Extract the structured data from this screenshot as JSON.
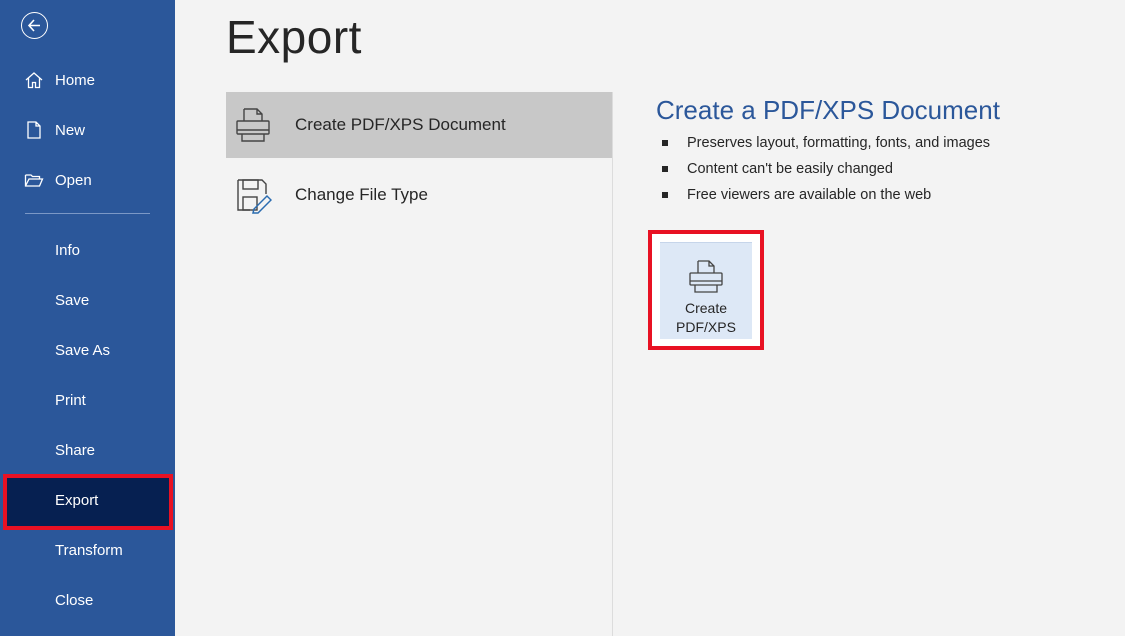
{
  "page": {
    "title": "Export"
  },
  "sidebar": {
    "items_top": [
      {
        "label": "Home",
        "icon": "home-icon"
      },
      {
        "label": "New",
        "icon": "new-document-icon"
      },
      {
        "label": "Open",
        "icon": "open-folder-icon"
      }
    ],
    "items_bottom": [
      {
        "label": "Info"
      },
      {
        "label": "Save"
      },
      {
        "label": "Save As"
      },
      {
        "label": "Print"
      },
      {
        "label": "Share"
      },
      {
        "label": "Export"
      },
      {
        "label": "Transform"
      },
      {
        "label": "Close"
      }
    ]
  },
  "options": [
    {
      "label": "Create PDF/XPS Document",
      "icon": "pdf-printer-icon"
    },
    {
      "label": "Change File Type",
      "icon": "change-file-type-icon"
    }
  ],
  "detail": {
    "title": "Create a PDF/XPS Document",
    "bullets": [
      "Preserves layout, formatting, fonts, and images",
      "Content can't be easily changed",
      "Free viewers are available on the web"
    ],
    "button_label": "Create PDF/XPS"
  },
  "colors": {
    "sidebar": "#2b579a",
    "selected": "#062051",
    "highlight": "#e81123",
    "accent": "#2b579a"
  }
}
